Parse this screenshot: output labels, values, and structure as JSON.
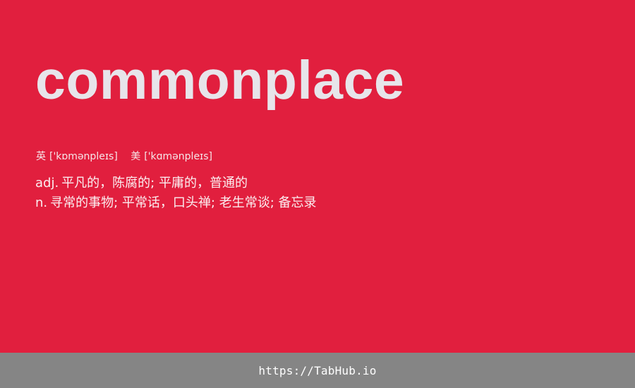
{
  "entry": {
    "word": "commonplace",
    "phonetics": [
      {
        "region": "英",
        "ipa": "['kɒmənpleɪs]"
      },
      {
        "region": "美",
        "ipa": "['kɑmənpleɪs]"
      }
    ],
    "definitions": [
      {
        "pos": "adj.",
        "meaning": "平凡的，陈腐的; 平庸的，普通的"
      },
      {
        "pos": "n.",
        "meaning": "寻常的事物; 平常话，口头禅; 老生常谈; 备忘录"
      }
    ]
  },
  "footer": {
    "url": "https://TabHub.io"
  },
  "colors": {
    "background": "#e11f3e",
    "footer": "#858585",
    "word": "#e7e5ea"
  }
}
